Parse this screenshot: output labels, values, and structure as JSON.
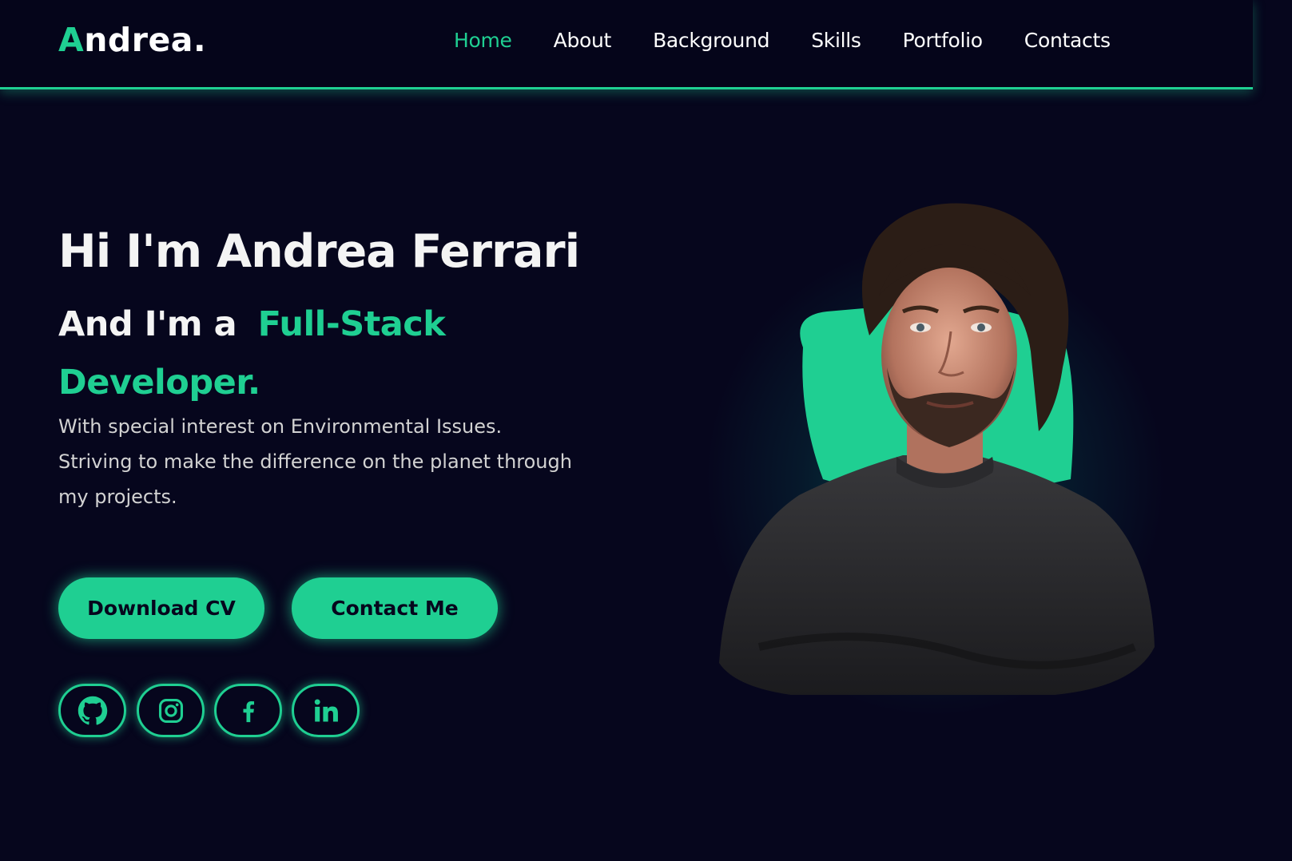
{
  "header": {
    "logo_first": "A",
    "logo_rest": "ndrea.",
    "nav": [
      {
        "label": "Home",
        "active": true
      },
      {
        "label": "About",
        "active": false
      },
      {
        "label": "Background",
        "active": false
      },
      {
        "label": "Skills",
        "active": false
      },
      {
        "label": "Portfolio",
        "active": false
      },
      {
        "label": "Contacts",
        "active": false
      }
    ]
  },
  "hero": {
    "title": "Hi I'm Andrea Ferrari",
    "subtitle_prefix": "And I'm a",
    "role": "Full-Stack Developer.",
    "description": "With special interest on Environmental Issues. Striving to make the difference on the planet through my projects."
  },
  "buttons": {
    "download_cv": "Download CV",
    "contact_me": "Contact Me"
  },
  "socials": [
    {
      "icon": "github-icon"
    },
    {
      "icon": "instagram-icon"
    },
    {
      "icon": "facebook-icon"
    },
    {
      "icon": "linkedin-icon"
    }
  ],
  "colors": {
    "accent": "#1fcf92",
    "background": "#06061d",
    "text": "#ffffff",
    "muted_text": "#d2d2d2"
  }
}
